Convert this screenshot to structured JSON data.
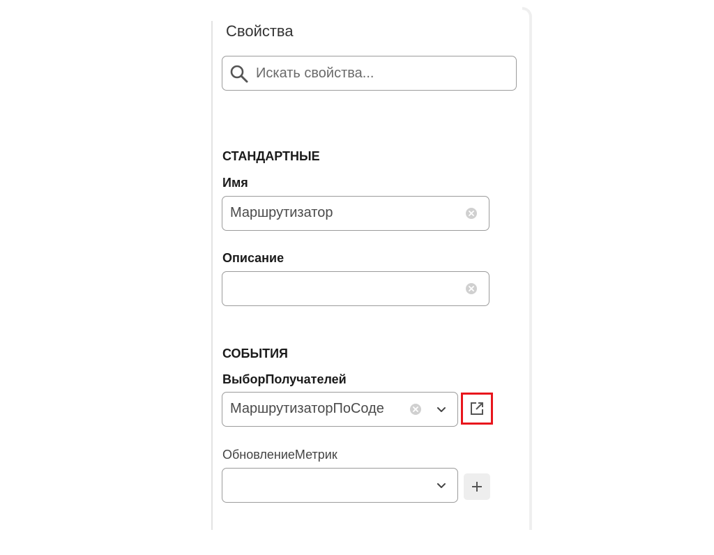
{
  "panel": {
    "title": "Свойства",
    "search": {
      "placeholder": "Искать свойства...",
      "value": "",
      "icon": "search-icon"
    }
  },
  "standard": {
    "title": "СТАНДАРТНЫЕ",
    "name": {
      "label": "Имя",
      "value": "Маршрутизатор"
    },
    "description": {
      "label": "Описание",
      "value": ""
    }
  },
  "events": {
    "title": "СОБЫТИЯ",
    "recipient_selection": {
      "label": "ВыборПолучателей",
      "value": "МаршрутизаторПоСоде"
    },
    "metrics_update": {
      "label": "ОбновлениеМетрик",
      "value": ""
    }
  },
  "colors": {
    "highlight": "#e8161d",
    "border": "#9b9b9b"
  }
}
